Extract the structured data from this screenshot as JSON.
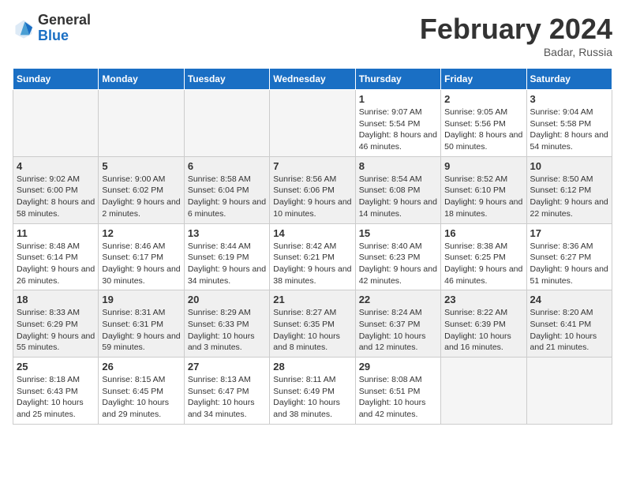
{
  "header": {
    "logo_general": "General",
    "logo_blue": "Blue",
    "month_title": "February 2024",
    "location": "Badar, Russia"
  },
  "weekdays": [
    "Sunday",
    "Monday",
    "Tuesday",
    "Wednesday",
    "Thursday",
    "Friday",
    "Saturday"
  ],
  "weeks": [
    [
      {
        "day": "",
        "info": ""
      },
      {
        "day": "",
        "info": ""
      },
      {
        "day": "",
        "info": ""
      },
      {
        "day": "",
        "info": ""
      },
      {
        "day": "1",
        "info": "Sunrise: 9:07 AM\nSunset: 5:54 PM\nDaylight: 8 hours\nand 46 minutes."
      },
      {
        "day": "2",
        "info": "Sunrise: 9:05 AM\nSunset: 5:56 PM\nDaylight: 8 hours\nand 50 minutes."
      },
      {
        "day": "3",
        "info": "Sunrise: 9:04 AM\nSunset: 5:58 PM\nDaylight: 8 hours\nand 54 minutes."
      }
    ],
    [
      {
        "day": "4",
        "info": "Sunrise: 9:02 AM\nSunset: 6:00 PM\nDaylight: 8 hours\nand 58 minutes."
      },
      {
        "day": "5",
        "info": "Sunrise: 9:00 AM\nSunset: 6:02 PM\nDaylight: 9 hours\nand 2 minutes."
      },
      {
        "day": "6",
        "info": "Sunrise: 8:58 AM\nSunset: 6:04 PM\nDaylight: 9 hours\nand 6 minutes."
      },
      {
        "day": "7",
        "info": "Sunrise: 8:56 AM\nSunset: 6:06 PM\nDaylight: 9 hours\nand 10 minutes."
      },
      {
        "day": "8",
        "info": "Sunrise: 8:54 AM\nSunset: 6:08 PM\nDaylight: 9 hours\nand 14 minutes."
      },
      {
        "day": "9",
        "info": "Sunrise: 8:52 AM\nSunset: 6:10 PM\nDaylight: 9 hours\nand 18 minutes."
      },
      {
        "day": "10",
        "info": "Sunrise: 8:50 AM\nSunset: 6:12 PM\nDaylight: 9 hours\nand 22 minutes."
      }
    ],
    [
      {
        "day": "11",
        "info": "Sunrise: 8:48 AM\nSunset: 6:14 PM\nDaylight: 9 hours\nand 26 minutes."
      },
      {
        "day": "12",
        "info": "Sunrise: 8:46 AM\nSunset: 6:17 PM\nDaylight: 9 hours\nand 30 minutes."
      },
      {
        "day": "13",
        "info": "Sunrise: 8:44 AM\nSunset: 6:19 PM\nDaylight: 9 hours\nand 34 minutes."
      },
      {
        "day": "14",
        "info": "Sunrise: 8:42 AM\nSunset: 6:21 PM\nDaylight: 9 hours\nand 38 minutes."
      },
      {
        "day": "15",
        "info": "Sunrise: 8:40 AM\nSunset: 6:23 PM\nDaylight: 9 hours\nand 42 minutes."
      },
      {
        "day": "16",
        "info": "Sunrise: 8:38 AM\nSunset: 6:25 PM\nDaylight: 9 hours\nand 46 minutes."
      },
      {
        "day": "17",
        "info": "Sunrise: 8:36 AM\nSunset: 6:27 PM\nDaylight: 9 hours\nand 51 minutes."
      }
    ],
    [
      {
        "day": "18",
        "info": "Sunrise: 8:33 AM\nSunset: 6:29 PM\nDaylight: 9 hours\nand 55 minutes."
      },
      {
        "day": "19",
        "info": "Sunrise: 8:31 AM\nSunset: 6:31 PM\nDaylight: 9 hours\nand 59 minutes."
      },
      {
        "day": "20",
        "info": "Sunrise: 8:29 AM\nSunset: 6:33 PM\nDaylight: 10 hours\nand 3 minutes."
      },
      {
        "day": "21",
        "info": "Sunrise: 8:27 AM\nSunset: 6:35 PM\nDaylight: 10 hours\nand 8 minutes."
      },
      {
        "day": "22",
        "info": "Sunrise: 8:24 AM\nSunset: 6:37 PM\nDaylight: 10 hours\nand 12 minutes."
      },
      {
        "day": "23",
        "info": "Sunrise: 8:22 AM\nSunset: 6:39 PM\nDaylight: 10 hours\nand 16 minutes."
      },
      {
        "day": "24",
        "info": "Sunrise: 8:20 AM\nSunset: 6:41 PM\nDaylight: 10 hours\nand 21 minutes."
      }
    ],
    [
      {
        "day": "25",
        "info": "Sunrise: 8:18 AM\nSunset: 6:43 PM\nDaylight: 10 hours\nand 25 minutes."
      },
      {
        "day": "26",
        "info": "Sunrise: 8:15 AM\nSunset: 6:45 PM\nDaylight: 10 hours\nand 29 minutes."
      },
      {
        "day": "27",
        "info": "Sunrise: 8:13 AM\nSunset: 6:47 PM\nDaylight: 10 hours\nand 34 minutes."
      },
      {
        "day": "28",
        "info": "Sunrise: 8:11 AM\nSunset: 6:49 PM\nDaylight: 10 hours\nand 38 minutes."
      },
      {
        "day": "29",
        "info": "Sunrise: 8:08 AM\nSunset: 6:51 PM\nDaylight: 10 hours\nand 42 minutes."
      },
      {
        "day": "",
        "info": ""
      },
      {
        "day": "",
        "info": ""
      }
    ]
  ]
}
